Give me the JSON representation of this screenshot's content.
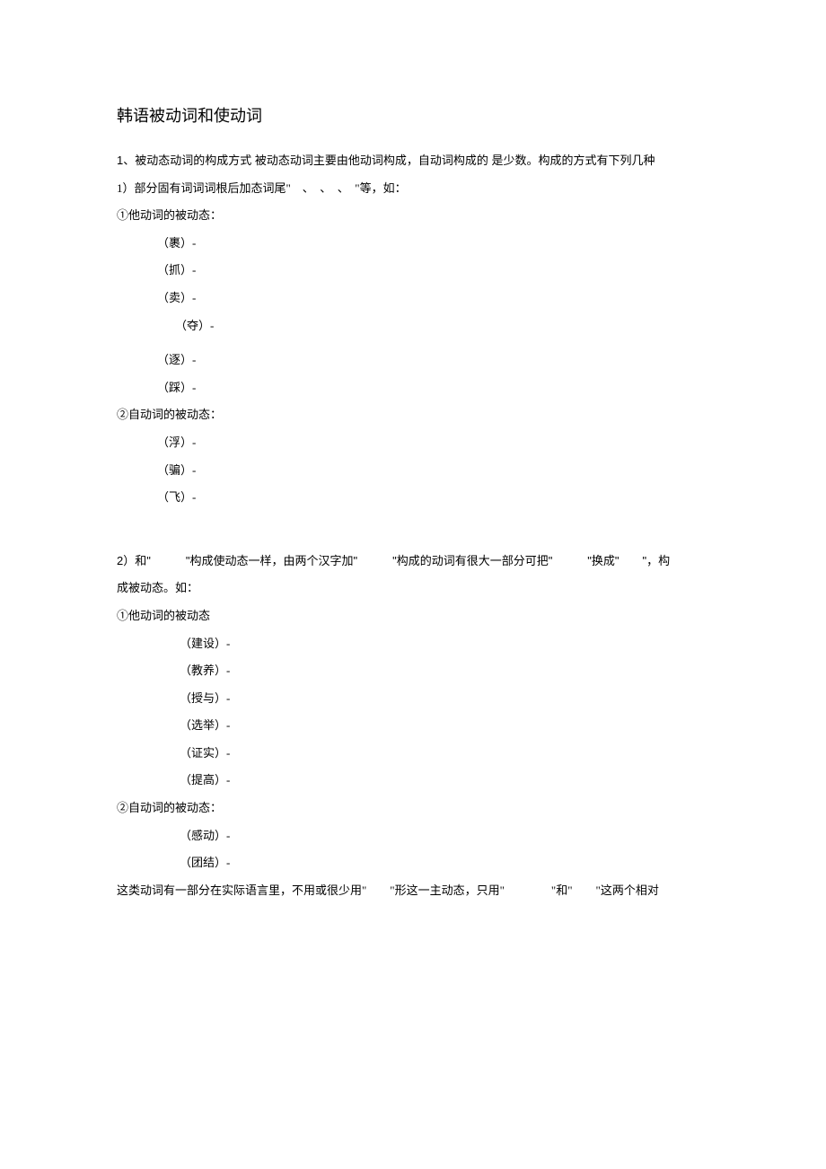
{
  "title": "韩语被动词和使动词",
  "section1": {
    "intro": "1、被动态动词的构成方式 被动态动词主要由他动词构成，自动词构成的 是少数。构成的方式有下列几种",
    "rule1": "1）部分固有词词词根后加态词尾\"　、　、　、　\"等，如：",
    "sub1_title": "①他动词的被动态：",
    "sub1_items": [
      "（裹）-",
      "（抓）-",
      "（卖）-",
      "  （夺）-",
      "（逐）-",
      "（踩）-"
    ],
    "sub2_title": "②自动词的被动态：",
    "sub2_items": [
      "（浮）-",
      "（骗）-",
      "（飞）-"
    ]
  },
  "section2": {
    "rule2": "2）和\"　　　\"构成使动态一样，由两个汉字加\"　　　\"构成的动词有很大一部分可把\"　　　\"换成\"　　\"，构",
    "rule2_cont": "成被动态。如：",
    "sub1_title": "①他动词的被动态",
    "sub1_items": [
      "（建设）-",
      "（教养）-",
      "（授与）-",
      "（选举）-",
      "（证实）-",
      "（提高）-"
    ],
    "sub2_title": "②自动词的被动态：",
    "sub2_items": [
      "（感动）-",
      "（团结）-"
    ],
    "note": "这类动词有一部分在实际语言里，不用或很少用\"　　\"形这一主动态，只用\"　　　　\"和\"　　\"这两个相对"
  }
}
